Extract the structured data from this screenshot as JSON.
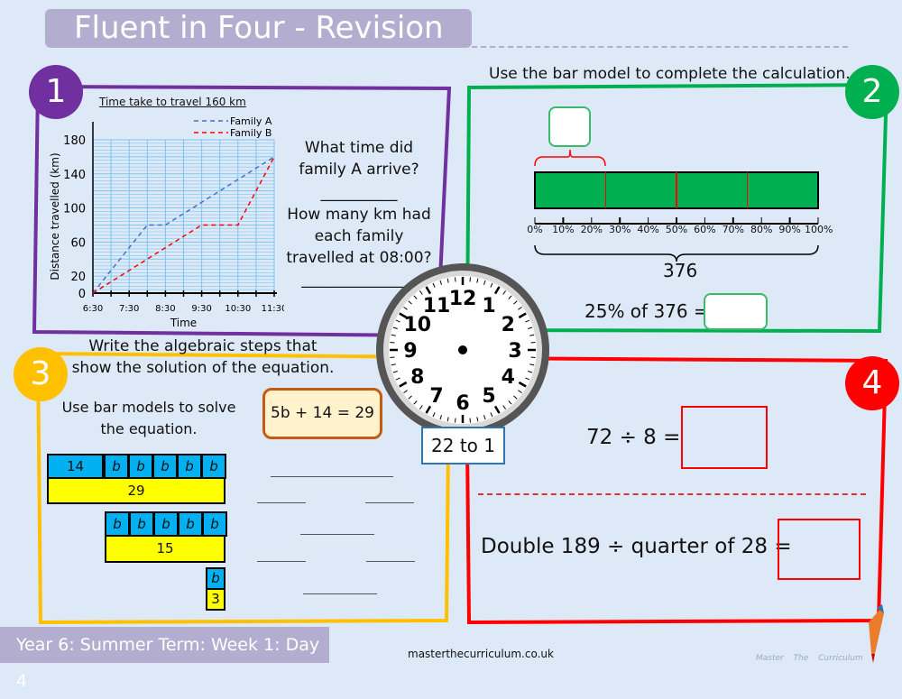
{
  "title": "Fluent in Four - Revision",
  "footer": {
    "course": "Year 6: Summer Term: Week 1: Day  4",
    "url": "masterthecurriculum.co.uk",
    "logo": "Master The Curriculum"
  },
  "colors": {
    "q1": "#7030a0",
    "q2": "#00b050",
    "q3": "#ffc000",
    "q4": "#ff0000",
    "header": "#b3aed0"
  },
  "q1": {
    "number": "1",
    "question1": "What time did family A arrive?",
    "blank1": "__________",
    "question2": "How many km had each family travelled at 08:00?",
    "blank2": "_______________"
  },
  "chart_data": {
    "type": "line",
    "title": "Time take to travel 160 km",
    "xlabel": "Time",
    "ylabel": "Distance travelled (km)",
    "x_ticks": [
      "6:30",
      "7:30",
      "8:30",
      "9:30",
      "10:30",
      "11:30"
    ],
    "y_ticks": [
      0,
      20,
      60,
      100,
      140,
      180
    ],
    "ylim": [
      0,
      180
    ],
    "grid": true,
    "legend": "top-right",
    "series": [
      {
        "name": "Family A",
        "color": "#4472c4",
        "points": [
          [
            "6:30",
            0
          ],
          [
            "8:00",
            80
          ],
          [
            "8:30",
            80
          ],
          [
            "11:30",
            160
          ]
        ]
      },
      {
        "name": "Family B",
        "color": "#ff0000",
        "points": [
          [
            "6:30",
            0
          ],
          [
            "9:30",
            80
          ],
          [
            "10:30",
            80
          ],
          [
            "11:30",
            160
          ]
        ]
      }
    ]
  },
  "q2": {
    "number": "2",
    "instruction": "Use the bar model to complete the calculation.",
    "percent_labels": [
      "0%",
      "10%",
      "20%",
      "30%",
      "40%",
      "50%",
      "60%",
      "70%",
      "80%",
      "90%",
      "100%"
    ],
    "total": "376",
    "question": "25% of 376 ="
  },
  "q3": {
    "number": "3",
    "instruction": "Write the algebraic steps that show the solution of the equation.",
    "sub": "Use bar models to solve the equation.",
    "equation": "5b + 14 = 29",
    "bar1_top": [
      "14",
      "b",
      "b",
      "b",
      "b",
      "b"
    ],
    "bar1_bottom": "29",
    "bar2_top": [
      "b",
      "b",
      "b",
      "b",
      "b"
    ],
    "bar2_bottom": "15",
    "bar3_top": "b",
    "bar3_bottom": "3"
  },
  "clock": {
    "numbers": [
      "12",
      "1",
      "2",
      "3",
      "4",
      "5",
      "6",
      "7",
      "8",
      "9",
      "10",
      "11"
    ],
    "label": "22 to 1"
  },
  "q4": {
    "number": "4",
    "question1": "72 ÷ 8 =",
    "question2": "Double 189 ÷ quarter of 28 ="
  }
}
